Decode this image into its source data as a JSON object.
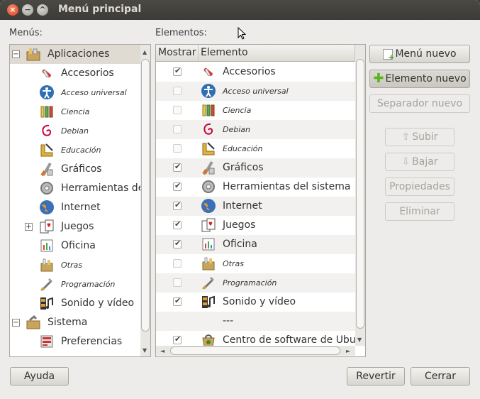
{
  "window": {
    "title": "Menú principal"
  },
  "labels": {
    "menus": "Menús:",
    "elements": "Elementos:"
  },
  "menus_tree": [
    {
      "label": "Aplicaciones",
      "italic": false,
      "expander": "−",
      "level": 0,
      "icon": "applications-icon",
      "selected": true
    },
    {
      "label": "Accesorios",
      "italic": false,
      "level": 1,
      "icon": "accessories-icon"
    },
    {
      "label": "Acceso universal",
      "italic": true,
      "level": 1,
      "icon": "universal-access-icon"
    },
    {
      "label": "Ciencia",
      "italic": true,
      "level": 1,
      "icon": "science-icon"
    },
    {
      "label": "Debian",
      "italic": true,
      "level": 1,
      "icon": "debian-icon"
    },
    {
      "label": "Educación",
      "italic": true,
      "level": 1,
      "icon": "education-icon"
    },
    {
      "label": "Gráficos",
      "italic": false,
      "level": 1,
      "icon": "graphics-icon"
    },
    {
      "label": "Herramientas de",
      "italic": false,
      "level": 1,
      "icon": "system-tools-icon"
    },
    {
      "label": "Internet",
      "italic": false,
      "level": 1,
      "icon": "internet-icon"
    },
    {
      "label": "Juegos",
      "italic": false,
      "expander": "+",
      "level": 1,
      "icon": "games-icon"
    },
    {
      "label": "Oficina",
      "italic": false,
      "level": 1,
      "icon": "office-icon"
    },
    {
      "label": "Otras",
      "italic": true,
      "level": 1,
      "icon": "other-icon"
    },
    {
      "label": "Programación",
      "italic": true,
      "level": 1,
      "icon": "programming-icon"
    },
    {
      "label": "Sonido y vídeo",
      "italic": false,
      "level": 1,
      "icon": "sound-video-icon"
    },
    {
      "label": "Sistema",
      "italic": false,
      "expander": "−",
      "level": 0,
      "icon": "system-icon"
    },
    {
      "label": "Preferencias",
      "italic": false,
      "level": 1,
      "icon": "preferences-icon"
    }
  ],
  "elements_table": {
    "columns": {
      "show": "Mostrar",
      "element": "Elemento"
    },
    "rows": [
      {
        "label": "Accesorios",
        "checked": true,
        "italic": false,
        "icon": "accessories-icon"
      },
      {
        "label": "Acceso universal",
        "checked": false,
        "italic": true,
        "icon": "universal-access-icon"
      },
      {
        "label": "Ciencia",
        "checked": false,
        "italic": true,
        "icon": "science-icon"
      },
      {
        "label": "Debian",
        "checked": false,
        "italic": true,
        "icon": "debian-icon"
      },
      {
        "label": "Educación",
        "checked": false,
        "italic": true,
        "icon": "education-icon"
      },
      {
        "label": "Gráficos",
        "checked": true,
        "italic": false,
        "icon": "graphics-icon"
      },
      {
        "label": "Herramientas del sistema",
        "checked": true,
        "italic": false,
        "icon": "system-tools-icon"
      },
      {
        "label": "Internet",
        "checked": true,
        "italic": false,
        "icon": "internet-icon"
      },
      {
        "label": "Juegos",
        "checked": true,
        "italic": false,
        "icon": "games-icon"
      },
      {
        "label": "Oficina",
        "checked": true,
        "italic": false,
        "icon": "office-icon"
      },
      {
        "label": "Otras",
        "checked": false,
        "italic": true,
        "icon": "other-icon"
      },
      {
        "label": "Programación",
        "checked": false,
        "italic": true,
        "icon": "programming-icon"
      },
      {
        "label": "Sonido y vídeo",
        "checked": true,
        "italic": false,
        "icon": "sound-video-icon"
      },
      {
        "label": "---",
        "checked": null,
        "italic": false,
        "icon": ""
      },
      {
        "label": "Centro de software de Ubuntu",
        "checked": true,
        "italic": false,
        "icon": "software-center-icon"
      }
    ]
  },
  "buttons": {
    "new_menu": "Menú nuevo",
    "new_item": "Elemento nuevo",
    "new_separator": "Separador nuevo",
    "move_up": "Subir",
    "move_down": "Bajar",
    "properties": "Propiedades",
    "delete": "Eliminar",
    "help": "Ayuda",
    "revert": "Revertir",
    "close": "Cerrar"
  },
  "colors": {
    "selection": "#dfdbd2",
    "row_alt": "#f2f1f0",
    "titlebar": "#3c3b37"
  }
}
